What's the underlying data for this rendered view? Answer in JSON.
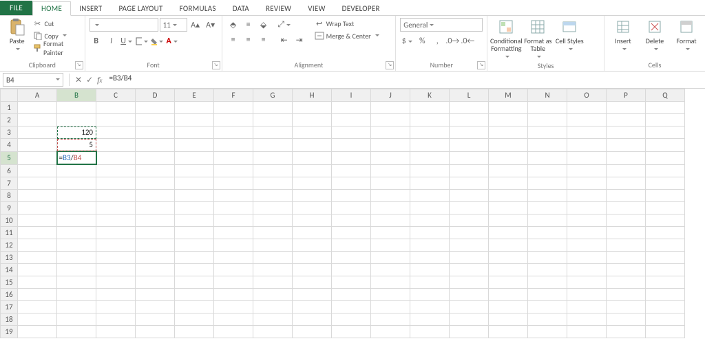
{
  "tabs": {
    "file": "FILE",
    "home": "HOME",
    "insert": "INSERT",
    "pagelayout": "PAGE LAYOUT",
    "formulas": "FORMULAS",
    "data": "DATA",
    "review": "REVIEW",
    "view": "VIEW",
    "developer": "DEVELOPER"
  },
  "clipboard": {
    "paste": "Paste",
    "cut": "Cut",
    "copy": "Copy",
    "fmtpainter": "Format Painter",
    "group": "Clipboard"
  },
  "font": {
    "size": "11",
    "bold": "B",
    "italic": "I",
    "underline": "U",
    "group": "Font"
  },
  "alignment": {
    "wrap": "Wrap Text",
    "merge": "Merge & Center",
    "group": "Alignment"
  },
  "number": {
    "format": "General",
    "group": "Number"
  },
  "styles": {
    "cond": "Conditional Formatting",
    "fat": "Format as Table",
    "cell": "Cell Styles",
    "group": "Styles"
  },
  "cellsgrp": {
    "insert": "Insert",
    "delete": "Delete",
    "format": "Format",
    "group": "Cells"
  },
  "namebox": "B4",
  "formula": "=B3/B4",
  "columns": [
    "A",
    "B",
    "C",
    "D",
    "E",
    "F",
    "G",
    "H",
    "I",
    "J",
    "K",
    "L",
    "M",
    "N",
    "O",
    "P",
    "Q"
  ],
  "rows": [
    "1",
    "2",
    "3",
    "4",
    "5",
    "6",
    "7",
    "8",
    "9",
    "10",
    "11",
    "12",
    "13",
    "14",
    "15",
    "16",
    "17",
    "18",
    "19"
  ],
  "cells": {
    "B3": "120",
    "B4": "5"
  },
  "b5_parts": {
    "eq": "=",
    "b3": "B3",
    "sl": "/",
    "b4": "B4"
  },
  "active": {
    "col": "B",
    "row": "5",
    "editRow": "5",
    "marqueeRows": [
      "3",
      "4"
    ]
  },
  "chart_data": null
}
